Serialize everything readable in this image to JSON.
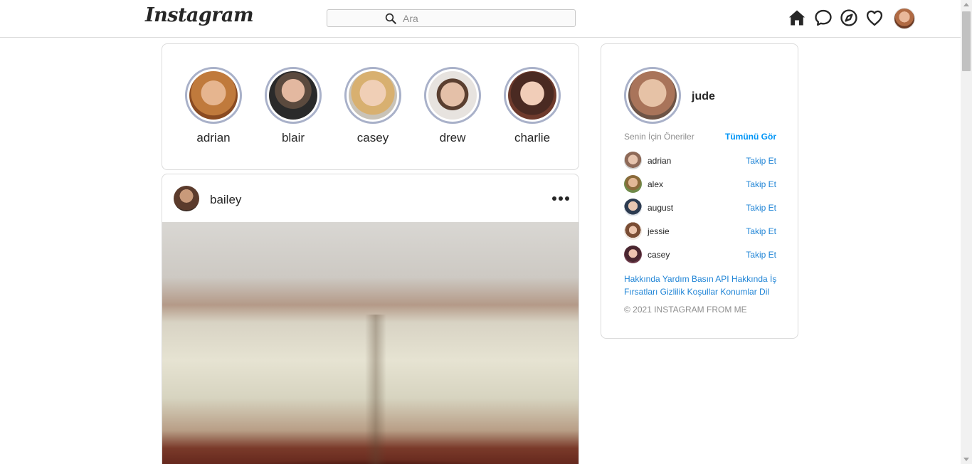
{
  "header": {
    "logo": "Instagram",
    "search_placeholder": "Ara",
    "icons": [
      "home-icon",
      "messenger-icon",
      "explore-icon",
      "heart-icon"
    ]
  },
  "stories": [
    {
      "name": "adrian"
    },
    {
      "name": "blair"
    },
    {
      "name": "casey"
    },
    {
      "name": "drew"
    },
    {
      "name": "charlie"
    }
  ],
  "post": {
    "username": "bailey"
  },
  "sidebar": {
    "username": "jude",
    "suggestions_title": "Senin İçin Öneriler",
    "see_all": "Tümünü Gör",
    "suggestions": [
      {
        "name": "adrian",
        "action": "Takip Et"
      },
      {
        "name": "alex",
        "action": "Takip Et"
      },
      {
        "name": "august",
        "action": "Takip Et"
      },
      {
        "name": "jessie",
        "action": "Takip Et"
      },
      {
        "name": "casey",
        "action": "Takip Et"
      }
    ],
    "links": "Hakkında Yardım Basın API Hakkında İş Fırsatları Gizlilik Koşullar Konumlar Dil",
    "copyright": "© 2021 INSTAGRAM FROM ME"
  },
  "colors": {
    "link": "#1f84d6",
    "see_all": "#0095f6",
    "story_ring": "#a9b1c9",
    "border": "#dbdbdb"
  }
}
